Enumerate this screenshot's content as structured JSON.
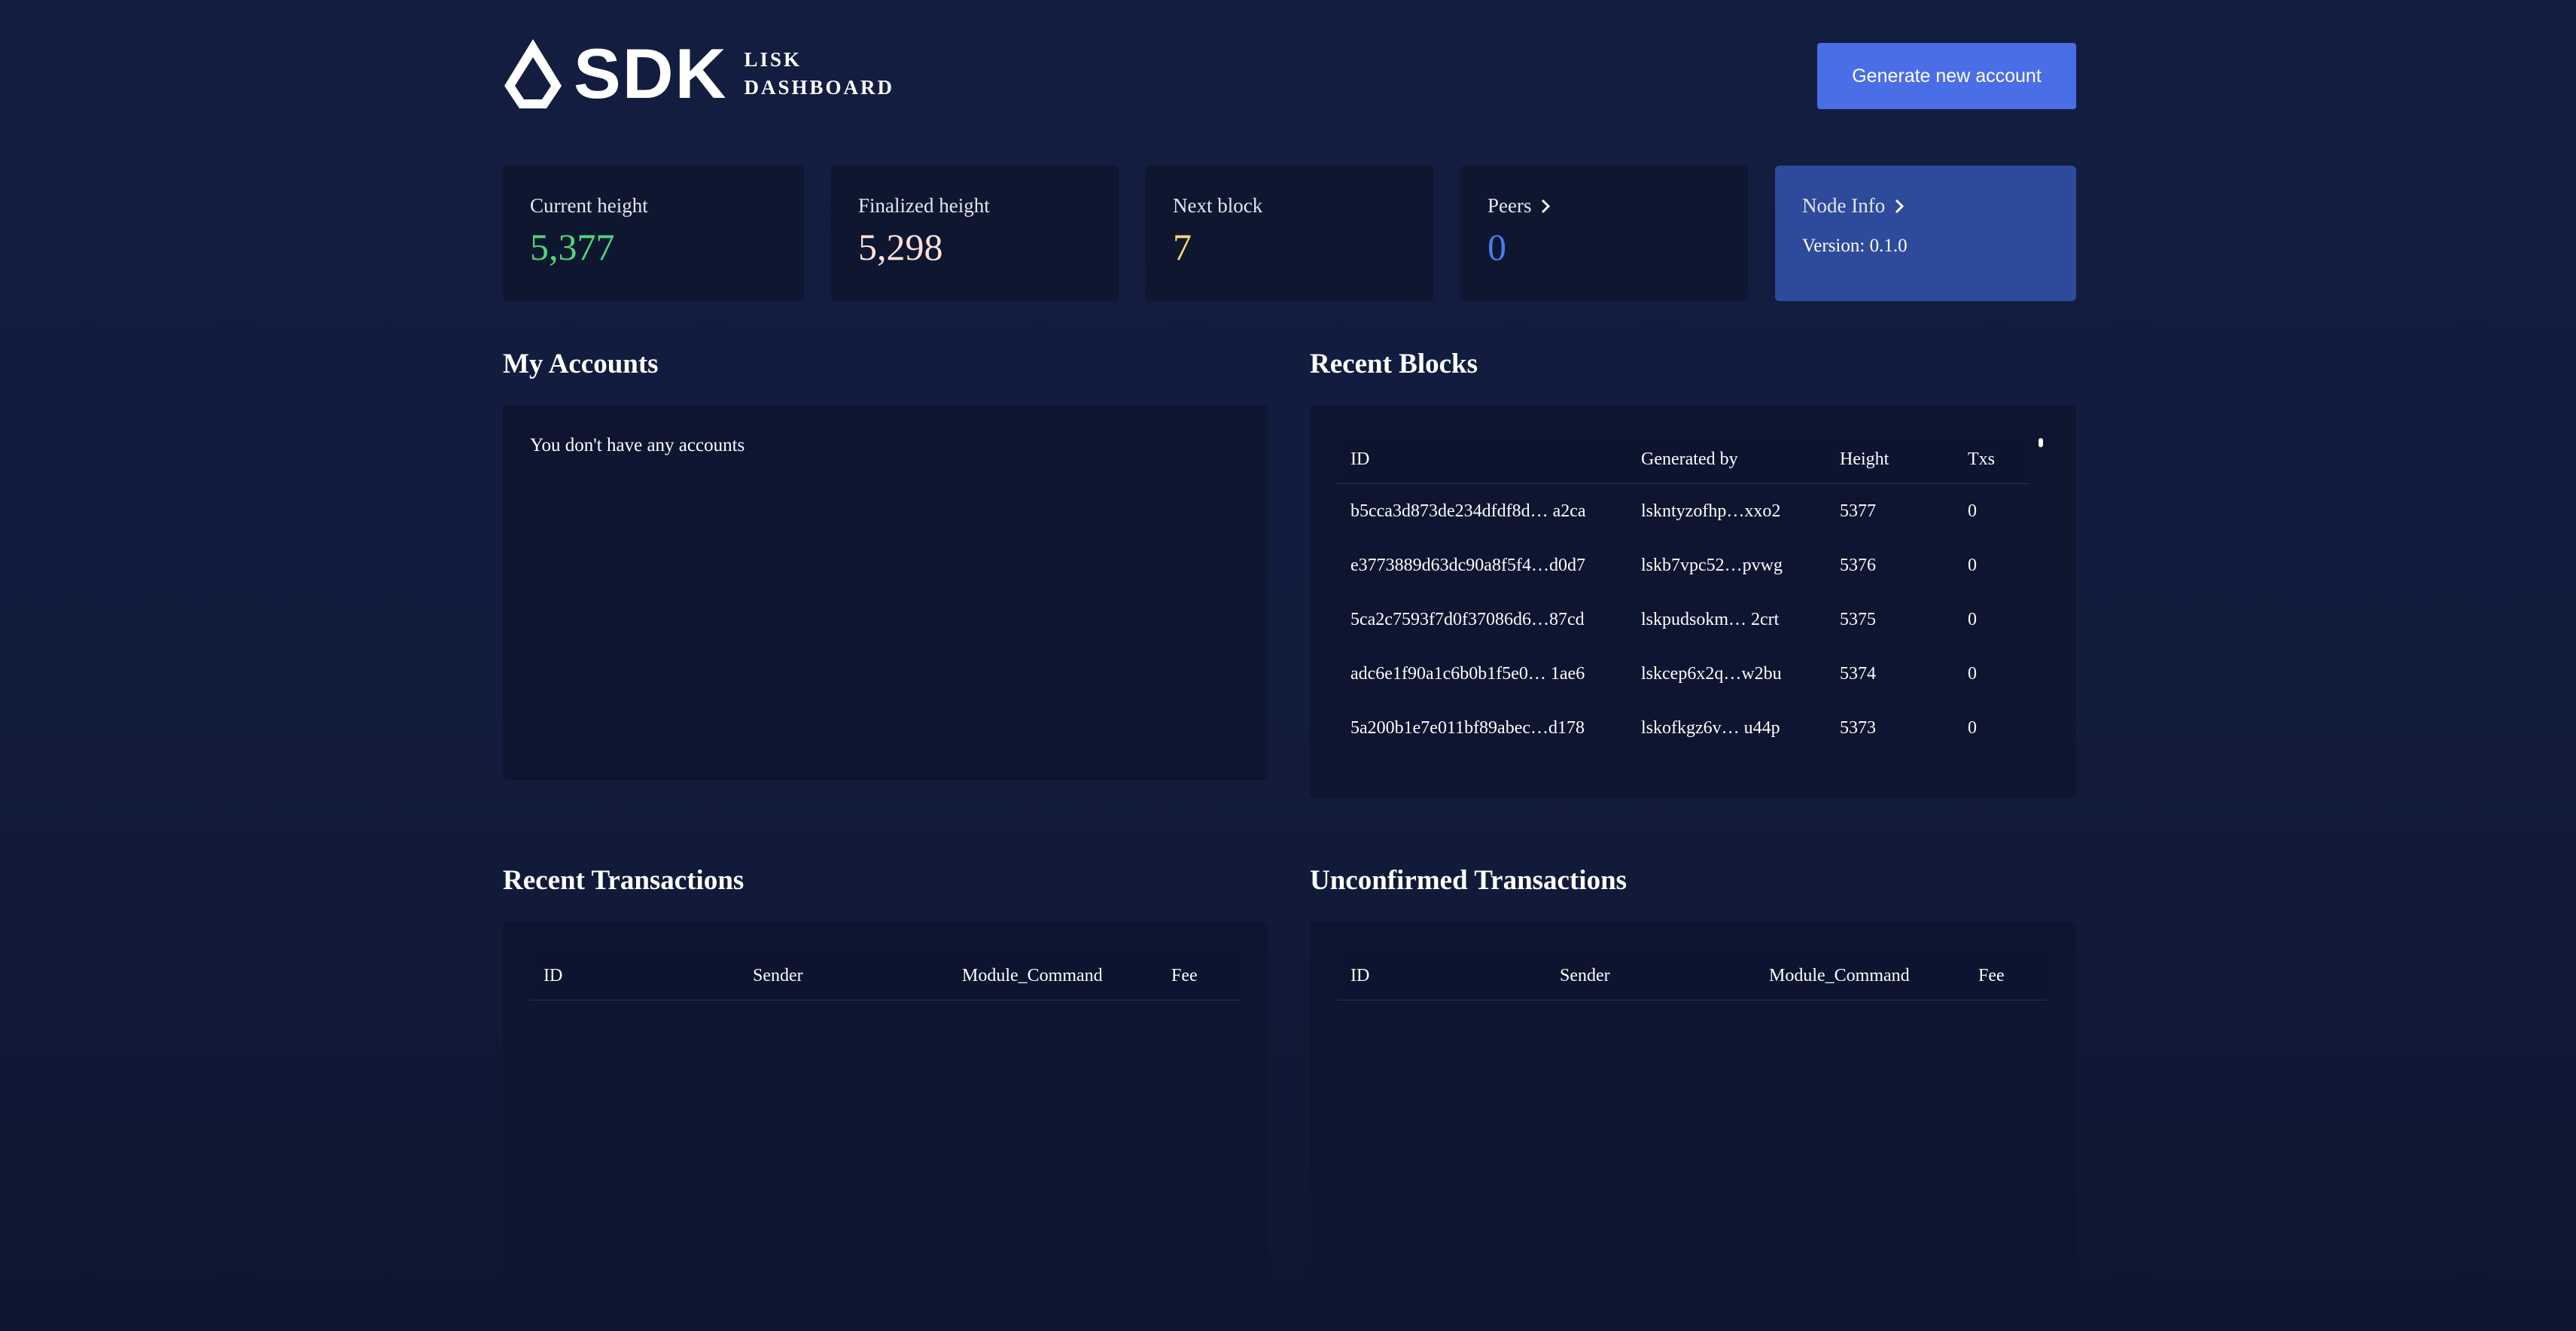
{
  "header": {
    "logo_sdk": "SDK",
    "logo_line1": "LISK",
    "logo_line2": "DASHBOARD",
    "generate_button": "Generate new account"
  },
  "stats": {
    "current_height": {
      "label": "Current height",
      "value": "5,377",
      "color": "#4cd97b"
    },
    "finalized_height": {
      "label": "Finalized height",
      "value": "5,298",
      "color": "#ffe0d8"
    },
    "next_block": {
      "label": "Next block",
      "value": "7",
      "color": "#f7d774"
    },
    "peers": {
      "label": "Peers",
      "value": "0",
      "color": "#4a7cf0"
    },
    "node_info": {
      "label": "Node Info",
      "version": "Version: 0.1.0"
    }
  },
  "accounts": {
    "title": "My Accounts",
    "empty_message": "You don't have any accounts"
  },
  "blocks": {
    "title": "Recent Blocks",
    "columns": [
      "ID",
      "Generated by",
      "Height",
      "Txs"
    ],
    "rows": [
      [
        "b5cca3d873de234dfdf8d… a2ca",
        "lskntyzofhp…xxo2",
        "5377",
        "0"
      ],
      [
        "e3773889d63dc90a8f5f4…d0d7",
        "lskb7vpc52…pvwg",
        "5376",
        "0"
      ],
      [
        "5ca2c7593f7d0f37086d6…87cd",
        "lskpudsokm… 2crt",
        "5375",
        "0"
      ],
      [
        "adc6e1f90a1c6b0b1f5e0… 1ae6",
        "lskcep6x2q…w2bu",
        "5374",
        "0"
      ],
      [
        "5a200b1e7e011bf89abec…d178",
        "lskofkgz6v… u44p",
        "5373",
        "0"
      ]
    ]
  },
  "recent_transactions": {
    "title": "Recent Transactions",
    "columns": [
      "ID",
      "Sender",
      "Module_Command",
      "Fee"
    ]
  },
  "unconfirmed_transactions": {
    "title": "Unconfirmed Transactions",
    "columns": [
      "ID",
      "Sender",
      "Module_Command",
      "Fee"
    ]
  },
  "icons": {
    "logo": "lisk-logo-icon",
    "chevron": "chevron-right-icon"
  }
}
